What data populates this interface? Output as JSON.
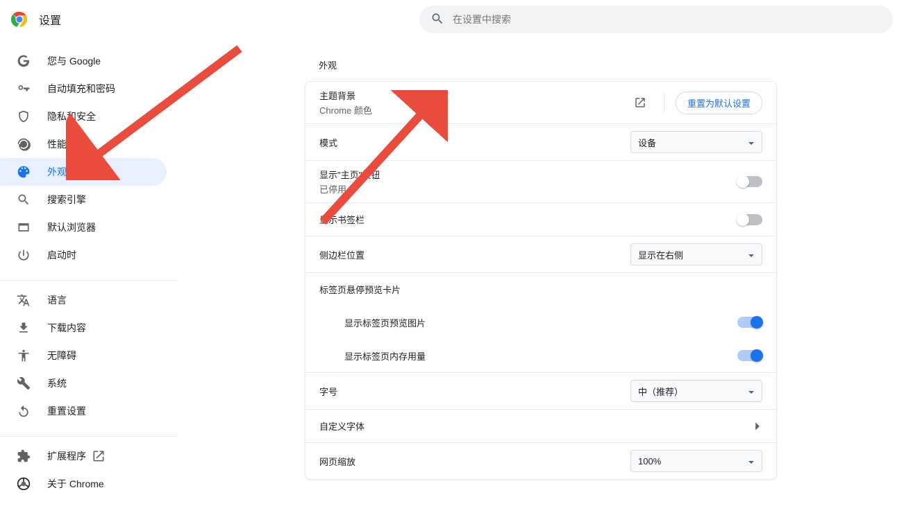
{
  "header": {
    "title": "设置",
    "search_placeholder": "在设置中搜索"
  },
  "sidebar": {
    "items": [
      {
        "label": "您与 Google",
        "icon": "google",
        "name": "sidebar-item-you-and-google"
      },
      {
        "label": "自动填充和密码",
        "icon": "key",
        "name": "sidebar-item-autofill"
      },
      {
        "label": "隐私和安全",
        "icon": "shield",
        "name": "sidebar-item-privacy"
      },
      {
        "label": "性能",
        "icon": "speed",
        "name": "sidebar-item-performance"
      },
      {
        "label": "外观",
        "icon": "appearance",
        "name": "sidebar-item-appearance",
        "active": true
      },
      {
        "label": "搜索引擎",
        "icon": "search",
        "name": "sidebar-item-search-engine"
      },
      {
        "label": "默认浏览器",
        "icon": "browser",
        "name": "sidebar-item-default-browser"
      },
      {
        "label": "启动时",
        "icon": "power",
        "name": "sidebar-item-on-startup"
      }
    ],
    "items2": [
      {
        "label": "语言",
        "icon": "language",
        "name": "sidebar-item-language"
      },
      {
        "label": "下载内容",
        "icon": "download",
        "name": "sidebar-item-downloads"
      },
      {
        "label": "无障碍",
        "icon": "accessibility",
        "name": "sidebar-item-accessibility"
      },
      {
        "label": "系统",
        "icon": "system",
        "name": "sidebar-item-system"
      },
      {
        "label": "重置设置",
        "icon": "reset",
        "name": "sidebar-item-reset"
      }
    ],
    "items3": [
      {
        "label": "扩展程序",
        "icon": "extensions",
        "name": "sidebar-item-extensions",
        "external": true
      },
      {
        "label": "关于 Chrome",
        "icon": "chrome",
        "name": "sidebar-item-about"
      }
    ]
  },
  "main": {
    "section_title": "外观",
    "theme": {
      "title": "主题背景",
      "subtitle": "Chrome 颜色",
      "reset_label": "重置为默认设置"
    },
    "mode": {
      "label": "模式",
      "value": "设备"
    },
    "home_button": {
      "label": "显示\"主页\"按钮",
      "sublabel": "已停用",
      "on": false
    },
    "bookmarks_bar": {
      "label": "显示书签栏",
      "on": false
    },
    "side_panel": {
      "label": "侧边栏位置",
      "value": "显示在右侧"
    },
    "tab_hover": {
      "label": "标签页悬停预览卡片"
    },
    "tab_preview_images": {
      "label": "显示标签页预览图片",
      "on": true
    },
    "tab_memory": {
      "label": "显示标签页内存用量",
      "on": true
    },
    "font_size": {
      "label": "字号",
      "value": "中（推荐）"
    },
    "custom_fonts": {
      "label": "自定义字体"
    },
    "page_zoom": {
      "label": "网页缩放",
      "value": "100%"
    }
  }
}
